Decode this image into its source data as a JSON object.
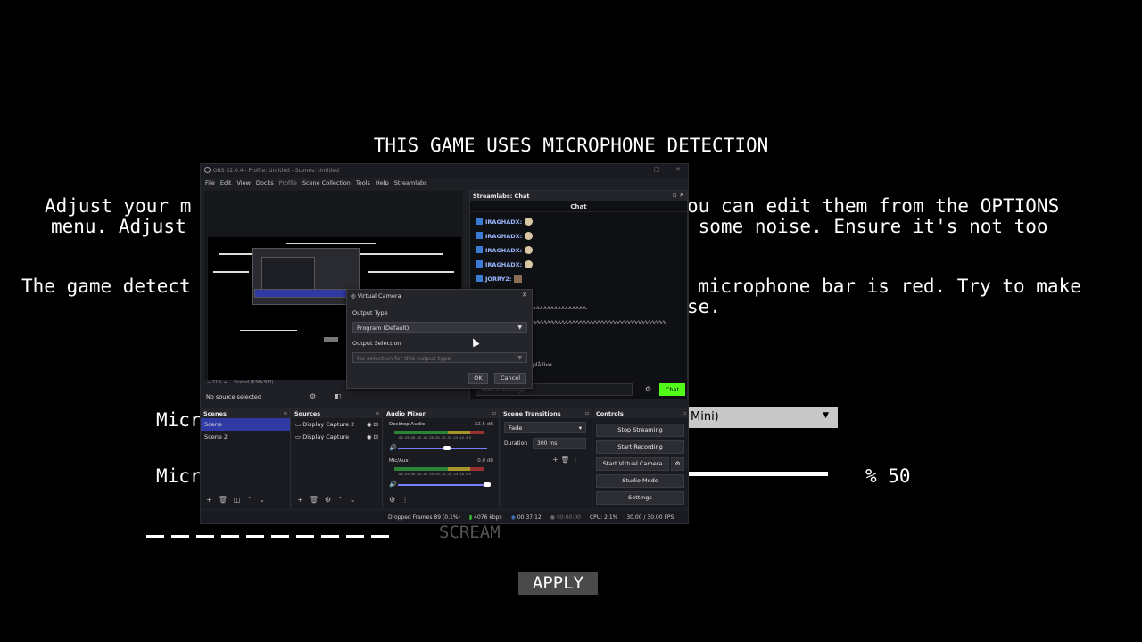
{
  "game": {
    "title": "THIS GAME USES MICROPHONE DETECTION",
    "line1_left": "Adjust your m",
    "line1_right": "ou can edit them from the OPTIONS",
    "line2_left": "menu. Adjust ",
    "line2_right": " some noise. Ensure it's not too",
    "line3_left": "The game detect",
    "line3_right": "microphone bar is red. Try to make",
    "line4_right": "se.",
    "mic_label_1": "Micr",
    "mic_label_2": "Micr",
    "mic_select_value": "Mini)",
    "sensitivity_value": "% 50",
    "sensitivity_fraction": 0.5,
    "scream_label": "SCREAM",
    "apply_label": "APPLY"
  },
  "obs": {
    "window_title": "OBS 32.0.4 - Profile: Untitled - Scenes: Untitled",
    "menu": [
      "File",
      "Edit",
      "View",
      "Docks",
      "Profile",
      "Scene Collection",
      "Tools",
      "Help",
      "Streamlabs"
    ],
    "preview_zoom": "21%",
    "preview_scale": "Scaled (638x302)",
    "no_source": "No source selected",
    "chat": {
      "dock_title": "Streamlabs: Chat",
      "header": "Chat",
      "messages": [
        "IRAGHADX:",
        "IRAGHADX:",
        "IRAGHADX:",
        "IRAGHADX:",
        "JORRY2:"
      ],
      "live_text": "plå live",
      "input_placeholder": "Send a message",
      "send_label": "Chat"
    },
    "scenes": {
      "title": "Scenes",
      "items": [
        "Scene",
        "Scene 2"
      ]
    },
    "sources": {
      "title": "Sources",
      "items": [
        "Display Capture 2",
        "Display Capture"
      ]
    },
    "mixer": {
      "title": "Audio Mixer",
      "channels": [
        {
          "name": "Desktop Audio",
          "db": "-22.5 dB",
          "volume": 0.55
        },
        {
          "name": "Mic/Aux",
          "db": "0.0 dB",
          "volume": 1.0
        }
      ],
      "scale": "-60 -55 -50 -45 -40 -35 -30 -25 -20 -15 -10 -5 0"
    },
    "transitions": {
      "title": "Scene Transitions",
      "type": "Fade",
      "duration_label": "Duration",
      "duration_value": "300 ms"
    },
    "controls": {
      "title": "Controls",
      "stop_streaming": "Stop Streaming",
      "start_recording": "Start Recording",
      "start_virtual_camera": "Start Virtual Camera",
      "studio_mode": "Studio Mode",
      "settings": "Settings"
    },
    "status": {
      "dropped_frames": "Dropped Frames 89 (0.1%)",
      "bitrate": "4076 kbps",
      "stream_time": "00:37:12",
      "rec_time": "00:00:00",
      "cpu": "CPU: 2.1%",
      "fps": "30.00 / 30.00 FPS"
    }
  },
  "vcam": {
    "title": "Virtual Camera",
    "output_type_label": "Output Type",
    "output_type_value": "Program (Default)",
    "output_selection_label": "Output Selection",
    "output_selection_value": "No selection for this output type",
    "ok_label": "OK",
    "cancel_label": "Cancel"
  },
  "colors": {
    "accent_blue": "#2f3aa5",
    "chat_green": "#53fc18",
    "obs_bg": "#1e1f24"
  }
}
